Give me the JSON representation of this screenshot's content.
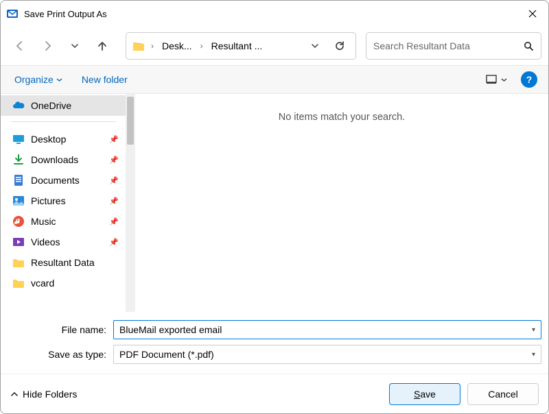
{
  "titlebar": {
    "title": "Save Print Output As"
  },
  "breadcrumb": {
    "seg1": "Desk...",
    "seg2": "Resultant ..."
  },
  "search": {
    "placeholder": "Search Resultant Data"
  },
  "toolbar": {
    "organize": "Organize",
    "newfolder": "New folder"
  },
  "sidebar": {
    "onedrive": "OneDrive",
    "items": [
      {
        "label": "Desktop",
        "pinned": true
      },
      {
        "label": "Downloads",
        "pinned": true
      },
      {
        "label": "Documents",
        "pinned": true
      },
      {
        "label": "Pictures",
        "pinned": true
      },
      {
        "label": "Music",
        "pinned": true
      },
      {
        "label": "Videos",
        "pinned": true
      },
      {
        "label": "Resultant Data",
        "pinned": false
      },
      {
        "label": "vcard",
        "pinned": false
      }
    ]
  },
  "content": {
    "empty": "No items match your search."
  },
  "form": {
    "filename_label": "File name:",
    "filename_value": "BlueMail exported email",
    "type_label": "Save as type:",
    "type_value": "PDF Document (*.pdf)"
  },
  "footer": {
    "hide": "Hide Folders",
    "save": "Save",
    "cancel": "Cancel"
  }
}
